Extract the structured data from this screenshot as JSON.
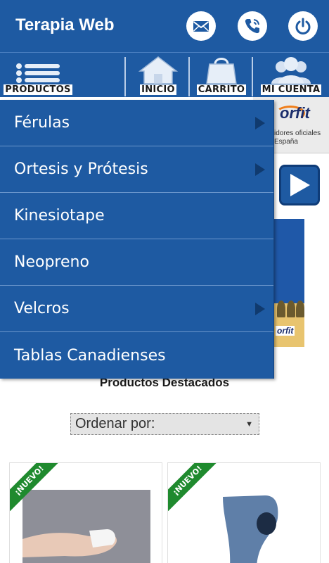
{
  "app": {
    "title": "Terapia Web"
  },
  "header_actions": [
    {
      "icon": "mail-icon"
    },
    {
      "icon": "phone-icon"
    },
    {
      "icon": "power-icon"
    }
  ],
  "nav": {
    "items": [
      {
        "label": "PRODUCTOS",
        "icon": "list-icon"
      },
      {
        "label": "INICIO",
        "icon": "home-icon"
      },
      {
        "label": "CARRITO",
        "icon": "shopping-bag-icon"
      },
      {
        "label": "MI CUENTA",
        "icon": "user-group-icon"
      }
    ]
  },
  "menu": {
    "items": [
      {
        "label": "Férulas",
        "has_submenu": true
      },
      {
        "label": "Ortesis y Prótesis",
        "has_submenu": true
      },
      {
        "label": "Kinesiotape",
        "has_submenu": false
      },
      {
        "label": "Neopreno",
        "has_submenu": false
      },
      {
        "label": "Velcros",
        "has_submenu": true
      },
      {
        "label": "Tablas Canadienses",
        "has_submenu": false
      }
    ]
  },
  "banner": {
    "logo": "orfit",
    "line1": "idores oficiales",
    "line2": "España"
  },
  "side_banner": {
    "logo": "orfit"
  },
  "main": {
    "section_title": "Productos Destacados",
    "sort": {
      "selected": "Ordenar por:"
    }
  },
  "products": [
    {
      "badge": "¡NUEVO!"
    },
    {
      "badge": "¡NUEVO!"
    }
  ],
  "colors": {
    "primary": "#1e5aa2",
    "ribbon": "#1f8a2e",
    "brand_orange": "#f07e1a"
  }
}
